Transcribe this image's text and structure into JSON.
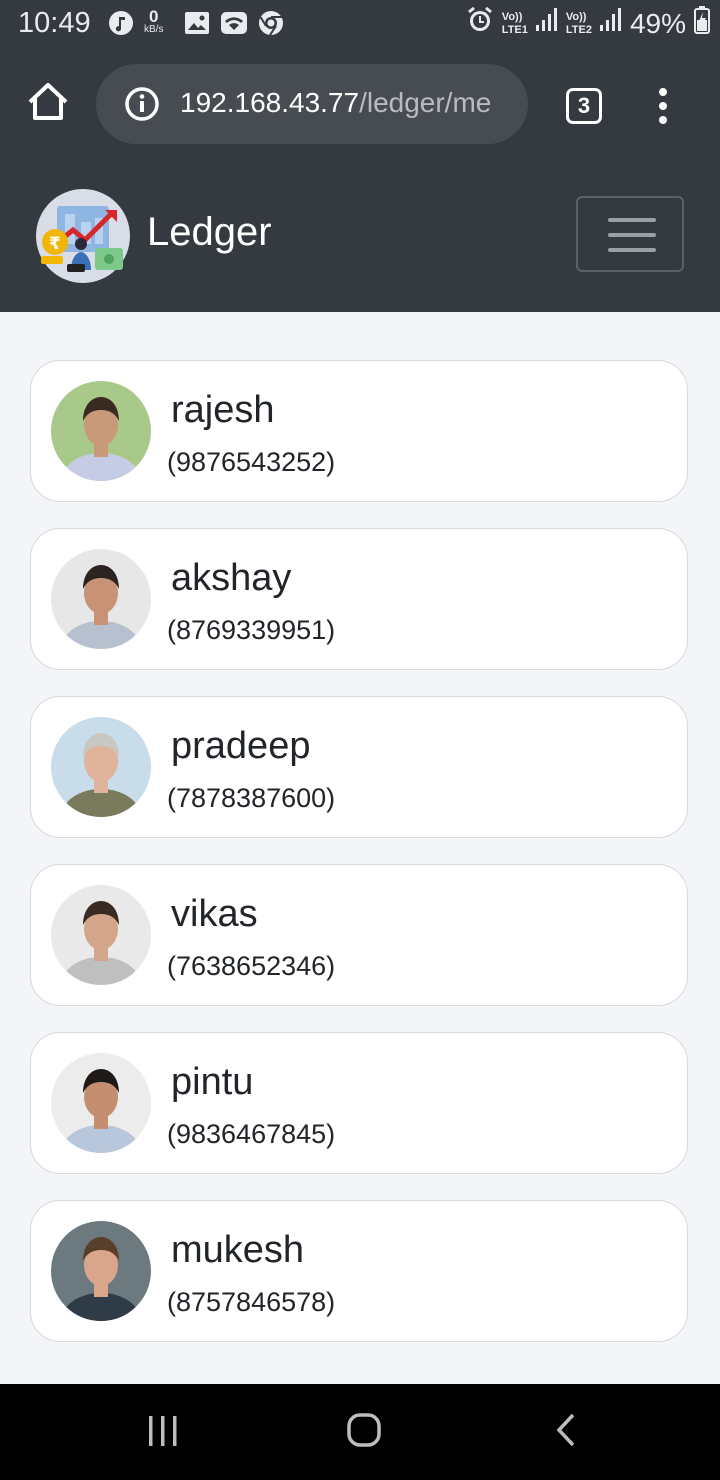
{
  "status_bar": {
    "time": "10:49",
    "net_speed_value": "0",
    "net_speed_unit": "kB/s",
    "battery": "49%",
    "sim1": "LTE1",
    "sim2": "LTE2",
    "volte": "Vo))",
    "icons": [
      "music-icon",
      "data-speed-icon",
      "gallery-icon",
      "wifi-icon",
      "chrome-icon",
      "alarm-icon",
      "signal-icon",
      "battery-icon"
    ]
  },
  "browser": {
    "url_host": "192.168.43.77",
    "url_path": "/ledger/me",
    "tab_count": "3"
  },
  "navbar": {
    "brand": "Ledger"
  },
  "contacts": [
    {
      "name": "rajesh",
      "phone": "(9876543252)",
      "avatar_bg": "#a9c98a",
      "avatar_shirt": "#c7cce6",
      "avatar_skin": "#c89a7a",
      "avatar_hair": "#3b2a22"
    },
    {
      "name": "akshay",
      "phone": "(8769339951)",
      "avatar_bg": "#e7e7e7",
      "avatar_shirt": "#b7c0cf",
      "avatar_skin": "#c79276",
      "avatar_hair": "#2c2420"
    },
    {
      "name": "pradeep",
      "phone": "(7878387600)",
      "avatar_bg": "#c8dcea",
      "avatar_shirt": "#7a7a5c",
      "avatar_skin": "#e0b49c",
      "avatar_hair": "#c9c7c2"
    },
    {
      "name": "vikas",
      "phone": "(7638652346)",
      "avatar_bg": "#e9e9e9",
      "avatar_shirt": "#bfbfbf",
      "avatar_skin": "#d3a58a",
      "avatar_hair": "#3a2b22"
    },
    {
      "name": "pintu",
      "phone": "(9836467845)",
      "avatar_bg": "#ececec",
      "avatar_shirt": "#b9c7dc",
      "avatar_skin": "#c38f70",
      "avatar_hair": "#1f1a17"
    },
    {
      "name": "mukesh",
      "phone": "(8757846578)",
      "avatar_bg": "#6c7a80",
      "avatar_shirt": "#2f3b47",
      "avatar_skin": "#d9a68b",
      "avatar_hair": "#5a3e2c"
    }
  ],
  "system_nav": {
    "buttons": [
      "recent-apps-button",
      "home-button",
      "back-button"
    ]
  }
}
